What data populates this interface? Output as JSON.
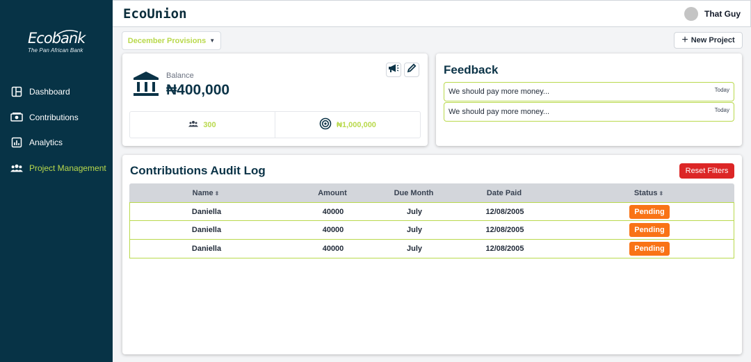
{
  "app_title": "EcoUnion",
  "user": {
    "name": "That Guy"
  },
  "brand": {
    "logo_text": "Ecobank",
    "tagline": "The Pan African Bank",
    "accent": "#b9d94c",
    "sidebar_bg": "#073346"
  },
  "sidebar": {
    "items": [
      {
        "label": "Dashboard",
        "icon": "dashboard-icon",
        "active": false
      },
      {
        "label": "Contributions",
        "icon": "money-icon",
        "active": false
      },
      {
        "label": "Analytics",
        "icon": "chart-icon",
        "active": false
      },
      {
        "label": "Project Management",
        "icon": "people-icon",
        "active": true
      }
    ]
  },
  "toolbar": {
    "provision_select": "December Provisions",
    "new_project_label": "New Project"
  },
  "balance": {
    "label": "Balance",
    "value": "₦400,000",
    "members": "300",
    "target": "₦1,000,000"
  },
  "feedback": {
    "title": "Feedback",
    "items": [
      {
        "text": "We should pay more money...",
        "time": "Today"
      },
      {
        "text": "We should pay more money...",
        "time": "Today"
      }
    ]
  },
  "audit": {
    "title": "Contributions Audit Log",
    "reset_label": "Reset Filters",
    "columns": [
      "Name",
      "Amount",
      "Due Month",
      "Date Paid",
      "Status"
    ],
    "rows": [
      {
        "name": "Daniella",
        "amount": "40000",
        "due": "July",
        "paid": "12/08/2005",
        "status": "Pending"
      },
      {
        "name": "Daniella",
        "amount": "40000",
        "due": "July",
        "paid": "12/08/2005",
        "status": "Pending"
      },
      {
        "name": "Daniella",
        "amount": "40000",
        "due": "July",
        "paid": "12/08/2005",
        "status": "Pending"
      }
    ],
    "status_color": "#f97316"
  }
}
